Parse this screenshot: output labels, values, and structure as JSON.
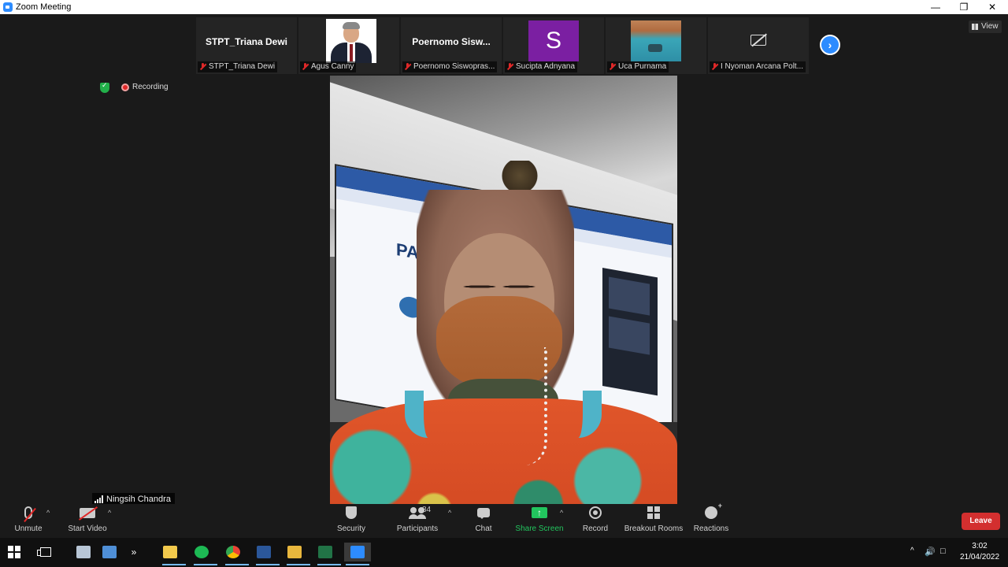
{
  "window": {
    "title": "Zoom Meeting",
    "controls": [
      "minimize-icon",
      "restore-icon",
      "close-icon"
    ]
  },
  "thumbnails": [
    {
      "display_name": "STPT_Triana Dewi",
      "caption": "STPT_Triana Dewi",
      "muted": true,
      "kind": "name"
    },
    {
      "display_name": "",
      "caption": "Agus Canny",
      "muted": true,
      "kind": "photo-portrait"
    },
    {
      "display_name": "Poernomo  Sisw...",
      "caption": "Poernomo Siswopras...",
      "muted": true,
      "kind": "name"
    },
    {
      "display_name": "S",
      "caption": "Sucipta Adnyana",
      "muted": true,
      "kind": "letter-avatar"
    },
    {
      "display_name": "",
      "caption": "Uca Purnama",
      "muted": true,
      "kind": "photo-sea"
    },
    {
      "display_name": "",
      "caption": "I Nyoman Arcana Polt...",
      "muted": true,
      "kind": "video-off"
    }
  ],
  "view_button": {
    "label": "View",
    "icon": "grid-icon"
  },
  "status": {
    "encryption_icon": "shield-check-icon",
    "recording_label": "Recording"
  },
  "speaker": {
    "name": "Ningsih Chandra",
    "screen_text": "PATA"
  },
  "toolbar": {
    "unmute_label": "Unmute",
    "start_video_label": "Start Video",
    "security_label": "Security",
    "participants_label": "Participants",
    "participants_count": "84",
    "chat_label": "Chat",
    "share_screen_label": "Share Screen",
    "record_label": "Record",
    "breakout_rooms_label": "Breakout Rooms",
    "reactions_label": "Reactions",
    "leave_label": "Leave"
  },
  "colors": {
    "accent_blue": "#2d8cff",
    "leave_red": "#d32f2f",
    "share_green": "#22c55e",
    "avatar_purple": "#7b1fa2"
  },
  "taskbar": {
    "apps": [
      "windows-start-icon",
      "task-view-icon",
      "desktop-icon",
      "laptop-icon",
      "overflow-icon",
      "file-explorer-icon",
      "spotify-icon",
      "chrome-icon",
      "word-icon",
      "folder-icon",
      "excel-icon",
      "zoom-icon"
    ],
    "overflow_label": "»",
    "time": "3:02",
    "date": "21/04/2022"
  }
}
